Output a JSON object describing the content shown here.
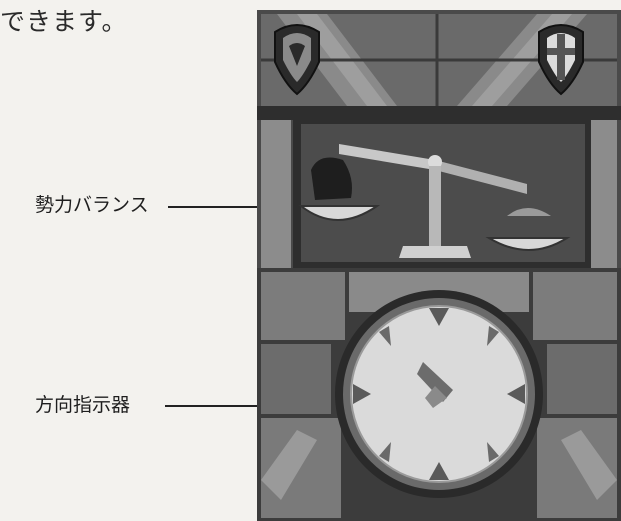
{
  "page": {
    "top_text": "できます。"
  },
  "callouts": {
    "balance_label": "勢力バランス",
    "direction_label": "方向指示器"
  },
  "panel": {
    "items": [
      "shield-emblem-left",
      "shield-emblem-right",
      "balance-scale",
      "direction-compass"
    ],
    "colors": {
      "stone_dark": "#2e2e2e",
      "stone_mid": "#6e6e6e",
      "stone_light": "#a8a8a8",
      "compass_face": "#dadada"
    }
  }
}
